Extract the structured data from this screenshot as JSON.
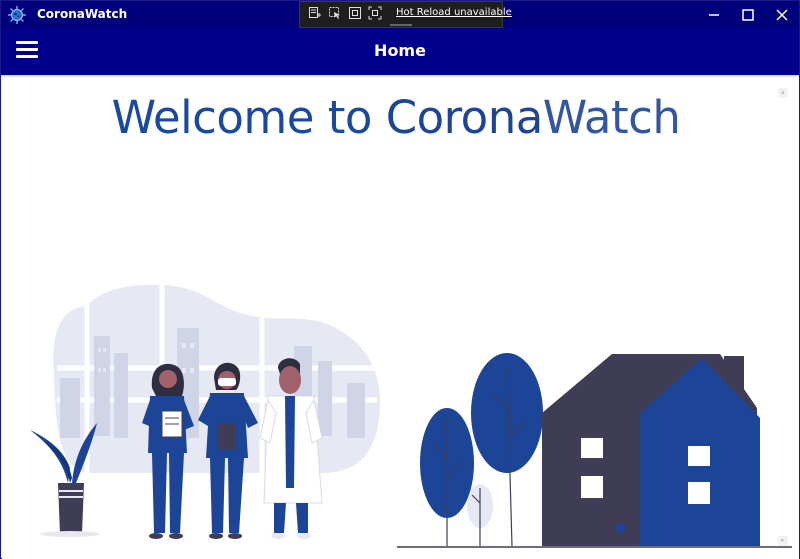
{
  "window": {
    "title": "CoronaWatch"
  },
  "debug_toolbar": {
    "hot_reload_label": "Hot Reload unavailable",
    "chevron": "‹"
  },
  "navbar": {
    "title": "Home"
  },
  "main": {
    "heading_part1": "Welcome to ",
    "heading_part2": "Corona",
    "heading_part3": "Watch"
  },
  "colors": {
    "titlebar": "#00007a",
    "navbar": "#00008a",
    "accent": "#1a4aa0",
    "illustration_dark": "#3f3d56"
  },
  "icons": {
    "app": "virus-icon",
    "minimize": "minimize-icon",
    "maximize": "maximize-icon",
    "close": "close-icon",
    "menu": "hamburger-menu-icon"
  }
}
